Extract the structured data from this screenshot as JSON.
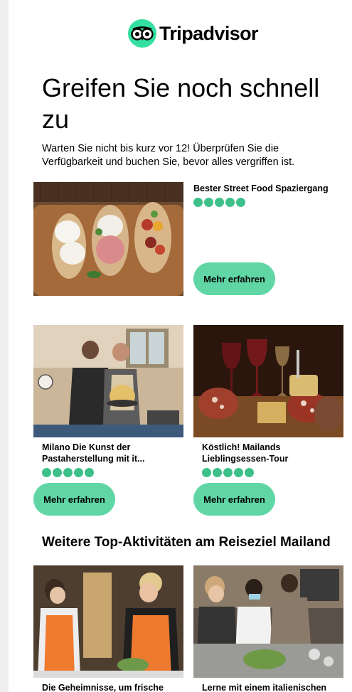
{
  "brand": {
    "name": "Tripadvisor",
    "accent": "#34e0a1",
    "button_color": "#5fd6a4",
    "rating_color": "#3ec08a"
  },
  "headline": "Greifen Sie noch schnell zu",
  "intro": "Warten Sie nicht bis kurz vor 12! Überprüfen Sie die Verfügbarkeit und buchen Sie, bevor alles vergriffen ist.",
  "featured": {
    "title": "Bester Street Food Spaziergang",
    "rating": 5,
    "button_label": "Mehr erfahren",
    "image": "bruschetta-photo"
  },
  "grid": [
    {
      "title": "Milano Die Kunst der Pastaherstellung mit it...",
      "rating": 5,
      "button_label": "Mehr erfahren",
      "image": "pasta-making-photo"
    },
    {
      "title": "Köstlich! Mailands Lieblingsessen-Tour",
      "rating": 5,
      "button_label": "Mehr erfahren",
      "image": "salami-wine-photo"
    }
  ],
  "more_section": {
    "heading": "Weitere Top-Aktivitäten am Reiseziel Mailand",
    "items": [
      {
        "title": "Die Geheimnisse, um frische",
        "image": "cooking-class-photo"
      },
      {
        "title": "Lerne mit einem italienischen",
        "image": "kitchen-class-photo"
      }
    ]
  }
}
